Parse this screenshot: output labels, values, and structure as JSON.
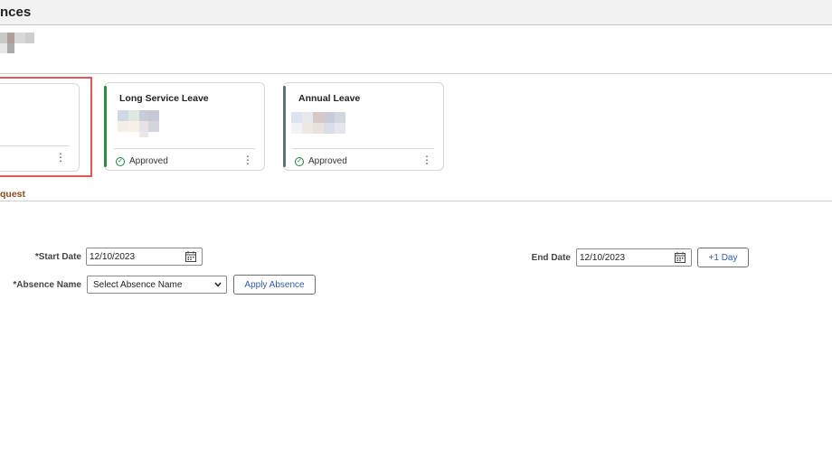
{
  "page": {
    "title": "nces"
  },
  "cards": [
    {
      "title": "",
      "status": "",
      "accent": ""
    },
    {
      "title": "Long Service Leave",
      "status": "Approved",
      "accent": "#2e8b3e"
    },
    {
      "title": "Annual Leave",
      "status": "Approved",
      "accent": "#5b7080"
    }
  ],
  "section": {
    "title": "quest"
  },
  "form": {
    "start_date_label": "*Start Date",
    "start_date_value": "12/10/2023",
    "end_date_label": "End Date",
    "end_date_value": "12/10/2023",
    "plus_one_day_label": "+1 Day",
    "absence_name_label": "*Absence Name",
    "absence_name_selected": "Select Absence Name",
    "apply_absence_label": "Apply Absence"
  },
  "icons": {
    "calendar": "calendar-icon",
    "status": "check-circle-icon",
    "more": "more-vertical-icon",
    "dropdown": "chevron-down-icon"
  },
  "colors": {
    "status_green": "#1a7f3c",
    "section_title": "#8a4a1f",
    "highlight": "#e0585b",
    "button_text": "#2f5aa8"
  }
}
